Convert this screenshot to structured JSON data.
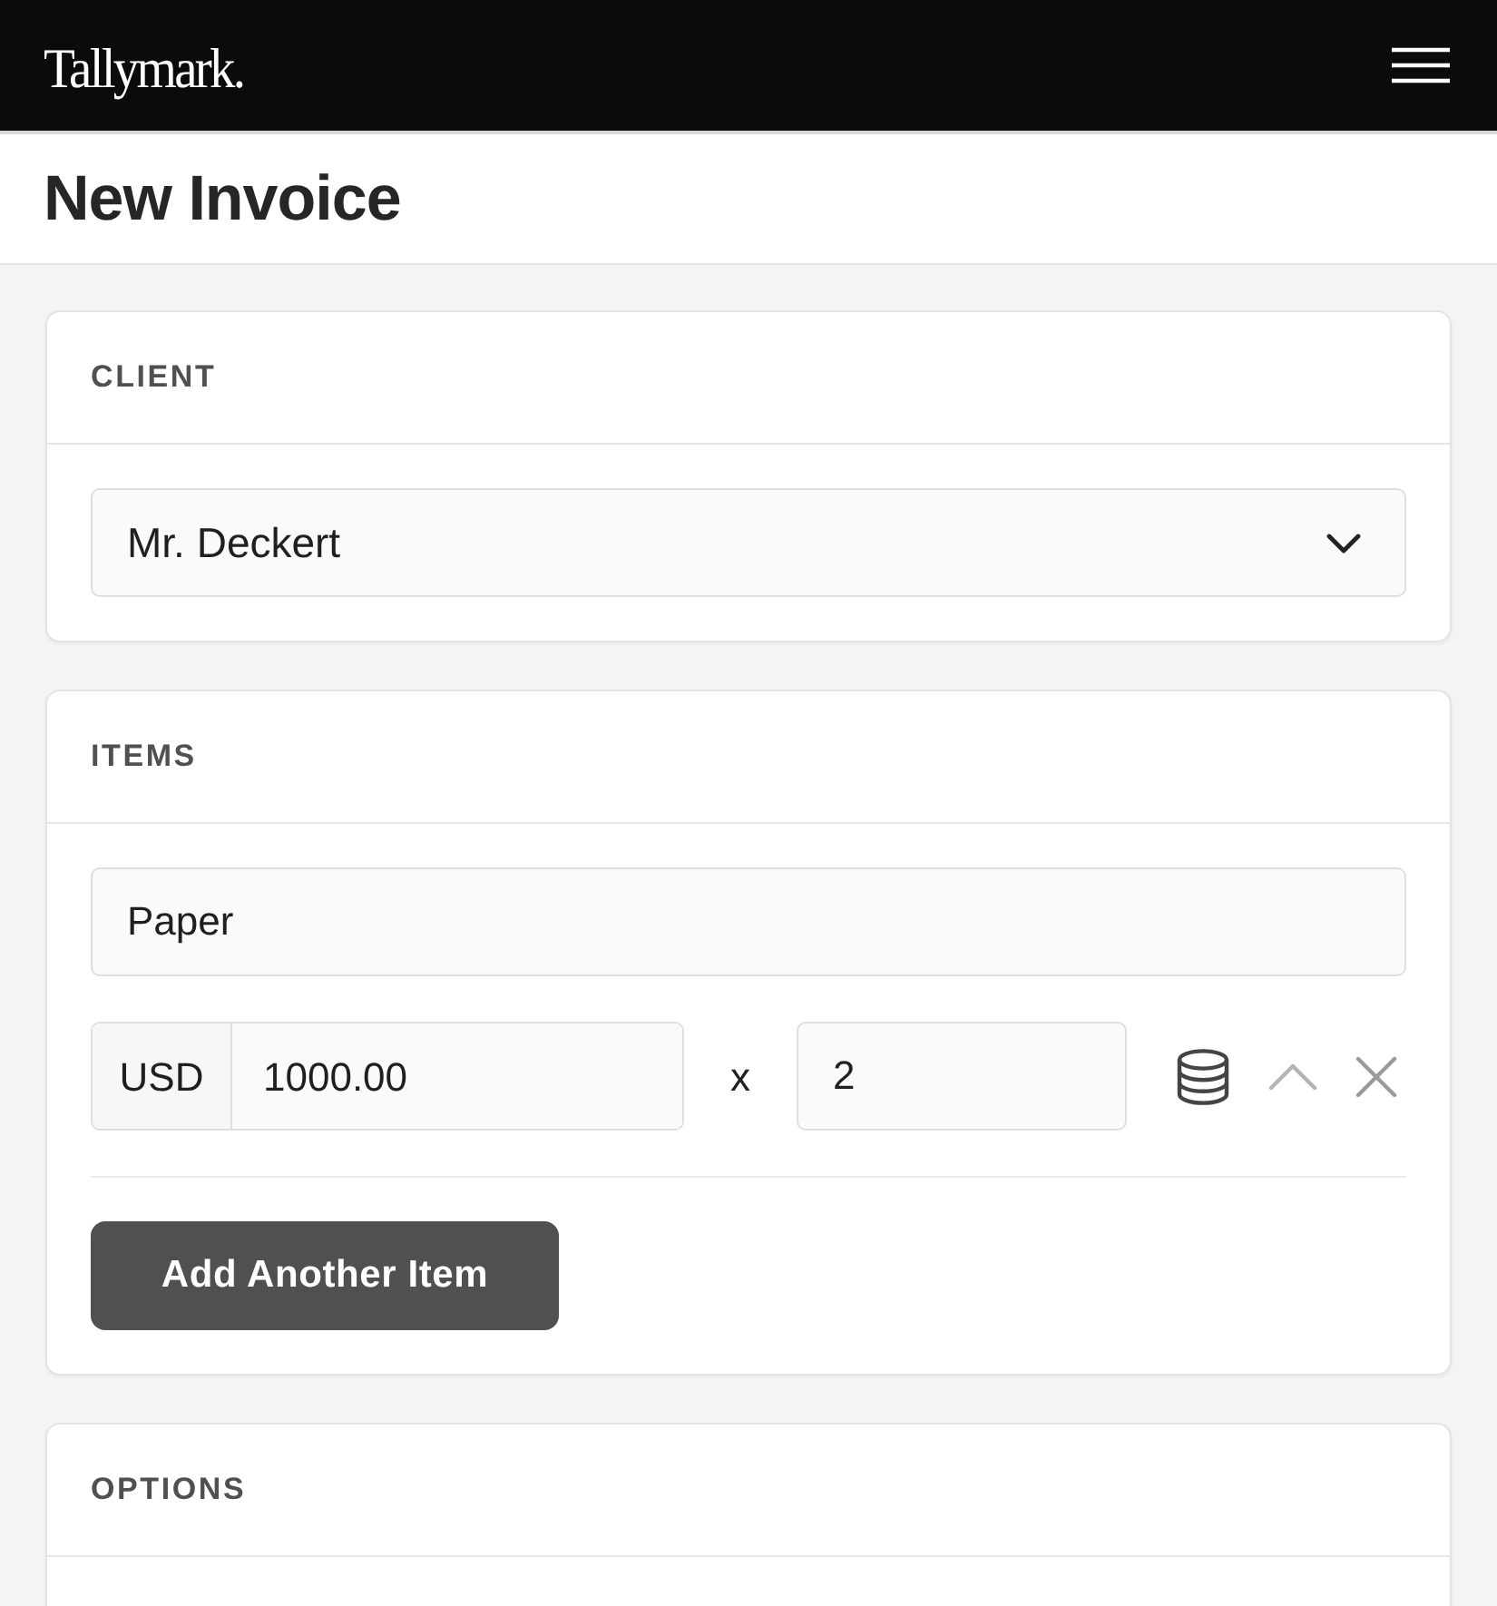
{
  "header": {
    "logo": "Tallymark."
  },
  "page": {
    "title": "New Invoice"
  },
  "sections": [
    {
      "kind": "client",
      "title": "CLIENT",
      "select": {
        "value": "Mr. Deckert"
      }
    },
    {
      "kind": "items",
      "title": "ITEMS",
      "items": [
        {
          "description": "Paper",
          "currency": "USD",
          "price": "1000.00",
          "times": "x",
          "quantity": "2"
        }
      ],
      "add_button": "Add Another Item"
    },
    {
      "kind": "options",
      "title": "OPTIONS"
    }
  ]
}
